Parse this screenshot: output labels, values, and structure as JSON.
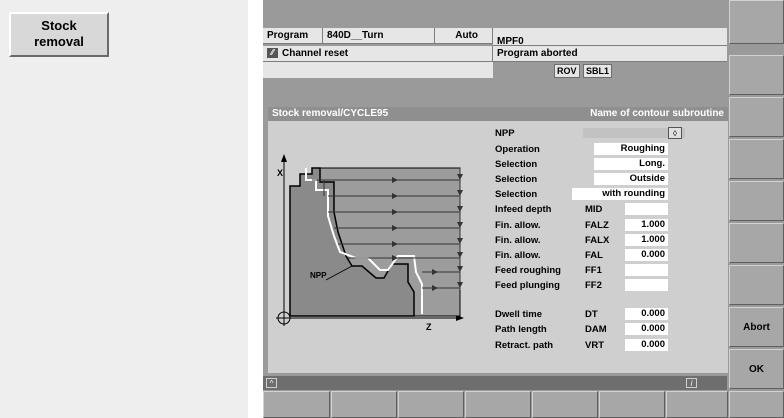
{
  "left_panel": {
    "stock_removal_button": "Stock\nremoval"
  },
  "header": {
    "area": "Program",
    "channel": "840D__Turn",
    "mode": "Auto",
    "program_name": "MPF0",
    "channel_message": "Channel reset",
    "program_status": "Program aborted",
    "flags": [
      "ROV",
      "SBL1"
    ]
  },
  "dialog": {
    "title": "Stock removal/CYCLE95",
    "hint": "Name of contour subroutine",
    "diagram": {
      "axis_x": "X",
      "axis_z": "Z",
      "point": "NPP"
    },
    "rows": [
      {
        "label": "NPP",
        "param": "",
        "value": ""
      },
      {
        "label": "Operation",
        "param": "",
        "value": "Roughing"
      },
      {
        "label": "Selection",
        "param": "",
        "value": "Long."
      },
      {
        "label": "Selection",
        "param": "",
        "value": "Outside"
      },
      {
        "label": "Selection",
        "param": "",
        "value": "with rounding"
      },
      {
        "label": "Infeed depth",
        "param": "MID",
        "value": ""
      },
      {
        "label": "Fin. allow.",
        "param": "FALZ",
        "value": "1.000"
      },
      {
        "label": "Fin. allow.",
        "param": "FALX",
        "value": "1.000"
      },
      {
        "label": "Fin. allow.",
        "param": "FAL",
        "value": "0.000"
      },
      {
        "label": "Feed roughing",
        "param": "FF1",
        "value": ""
      },
      {
        "label": "Feed plunging",
        "param": "FF2",
        "value": ""
      },
      {
        "label": "Dwell time",
        "param": "DT",
        "value": "0.000"
      },
      {
        "label": "Path length",
        "param": "DAM",
        "value": "0.000"
      },
      {
        "label": "Retract. path",
        "param": "VRT",
        "value": "0.000"
      }
    ]
  },
  "status_bar": {
    "up_icon": "caret-up-icon",
    "info_icon": "info-icon"
  },
  "softkeys": {
    "vertical": [
      "",
      "",
      "",
      "",
      "",
      "",
      "",
      "Abort",
      "OK"
    ],
    "horizontal": [
      "",
      "",
      "",
      "",
      "",
      "",
      "",
      ""
    ]
  }
}
